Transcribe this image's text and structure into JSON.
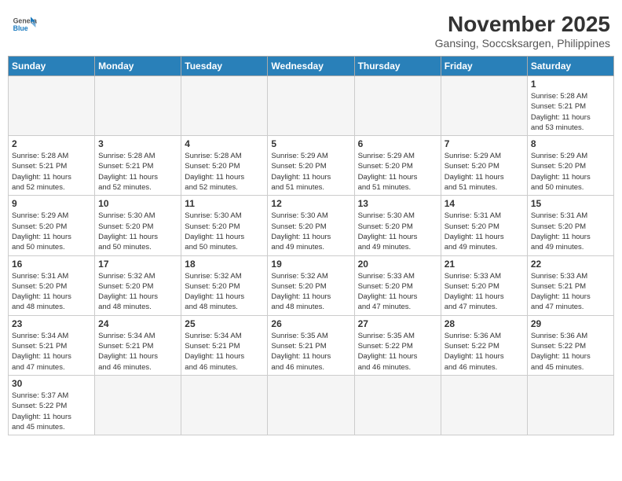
{
  "header": {
    "logo_text_general": "General",
    "logo_text_blue": "Blue",
    "month_title": "November 2025",
    "location": "Gansing, Soccsksargen, Philippines"
  },
  "calendar": {
    "days_of_week": [
      "Sunday",
      "Monday",
      "Tuesday",
      "Wednesday",
      "Thursday",
      "Friday",
      "Saturday"
    ],
    "weeks": [
      [
        {
          "day": "",
          "empty": true,
          "content": ""
        },
        {
          "day": "",
          "empty": true,
          "content": ""
        },
        {
          "day": "",
          "empty": true,
          "content": ""
        },
        {
          "day": "",
          "empty": true,
          "content": ""
        },
        {
          "day": "",
          "empty": true,
          "content": ""
        },
        {
          "day": "",
          "empty": true,
          "content": ""
        },
        {
          "day": "1",
          "empty": false,
          "content": "Sunrise: 5:28 AM\nSunset: 5:21 PM\nDaylight: 11 hours\nand 53 minutes."
        }
      ],
      [
        {
          "day": "2",
          "empty": false,
          "content": "Sunrise: 5:28 AM\nSunset: 5:21 PM\nDaylight: 11 hours\nand 52 minutes."
        },
        {
          "day": "3",
          "empty": false,
          "content": "Sunrise: 5:28 AM\nSunset: 5:21 PM\nDaylight: 11 hours\nand 52 minutes."
        },
        {
          "day": "4",
          "empty": false,
          "content": "Sunrise: 5:28 AM\nSunset: 5:20 PM\nDaylight: 11 hours\nand 52 minutes."
        },
        {
          "day": "5",
          "empty": false,
          "content": "Sunrise: 5:29 AM\nSunset: 5:20 PM\nDaylight: 11 hours\nand 51 minutes."
        },
        {
          "day": "6",
          "empty": false,
          "content": "Sunrise: 5:29 AM\nSunset: 5:20 PM\nDaylight: 11 hours\nand 51 minutes."
        },
        {
          "day": "7",
          "empty": false,
          "content": "Sunrise: 5:29 AM\nSunset: 5:20 PM\nDaylight: 11 hours\nand 51 minutes."
        },
        {
          "day": "8",
          "empty": false,
          "content": "Sunrise: 5:29 AM\nSunset: 5:20 PM\nDaylight: 11 hours\nand 50 minutes."
        }
      ],
      [
        {
          "day": "9",
          "empty": false,
          "content": "Sunrise: 5:29 AM\nSunset: 5:20 PM\nDaylight: 11 hours\nand 50 minutes."
        },
        {
          "day": "10",
          "empty": false,
          "content": "Sunrise: 5:30 AM\nSunset: 5:20 PM\nDaylight: 11 hours\nand 50 minutes."
        },
        {
          "day": "11",
          "empty": false,
          "content": "Sunrise: 5:30 AM\nSunset: 5:20 PM\nDaylight: 11 hours\nand 50 minutes."
        },
        {
          "day": "12",
          "empty": false,
          "content": "Sunrise: 5:30 AM\nSunset: 5:20 PM\nDaylight: 11 hours\nand 49 minutes."
        },
        {
          "day": "13",
          "empty": false,
          "content": "Sunrise: 5:30 AM\nSunset: 5:20 PM\nDaylight: 11 hours\nand 49 minutes."
        },
        {
          "day": "14",
          "empty": false,
          "content": "Sunrise: 5:31 AM\nSunset: 5:20 PM\nDaylight: 11 hours\nand 49 minutes."
        },
        {
          "day": "15",
          "empty": false,
          "content": "Sunrise: 5:31 AM\nSunset: 5:20 PM\nDaylight: 11 hours\nand 49 minutes."
        }
      ],
      [
        {
          "day": "16",
          "empty": false,
          "content": "Sunrise: 5:31 AM\nSunset: 5:20 PM\nDaylight: 11 hours\nand 48 minutes."
        },
        {
          "day": "17",
          "empty": false,
          "content": "Sunrise: 5:32 AM\nSunset: 5:20 PM\nDaylight: 11 hours\nand 48 minutes."
        },
        {
          "day": "18",
          "empty": false,
          "content": "Sunrise: 5:32 AM\nSunset: 5:20 PM\nDaylight: 11 hours\nand 48 minutes."
        },
        {
          "day": "19",
          "empty": false,
          "content": "Sunrise: 5:32 AM\nSunset: 5:20 PM\nDaylight: 11 hours\nand 48 minutes."
        },
        {
          "day": "20",
          "empty": false,
          "content": "Sunrise: 5:33 AM\nSunset: 5:20 PM\nDaylight: 11 hours\nand 47 minutes."
        },
        {
          "day": "21",
          "empty": false,
          "content": "Sunrise: 5:33 AM\nSunset: 5:20 PM\nDaylight: 11 hours\nand 47 minutes."
        },
        {
          "day": "22",
          "empty": false,
          "content": "Sunrise: 5:33 AM\nSunset: 5:21 PM\nDaylight: 11 hours\nand 47 minutes."
        }
      ],
      [
        {
          "day": "23",
          "empty": false,
          "content": "Sunrise: 5:34 AM\nSunset: 5:21 PM\nDaylight: 11 hours\nand 47 minutes."
        },
        {
          "day": "24",
          "empty": false,
          "content": "Sunrise: 5:34 AM\nSunset: 5:21 PM\nDaylight: 11 hours\nand 46 minutes."
        },
        {
          "day": "25",
          "empty": false,
          "content": "Sunrise: 5:34 AM\nSunset: 5:21 PM\nDaylight: 11 hours\nand 46 minutes."
        },
        {
          "day": "26",
          "empty": false,
          "content": "Sunrise: 5:35 AM\nSunset: 5:21 PM\nDaylight: 11 hours\nand 46 minutes."
        },
        {
          "day": "27",
          "empty": false,
          "content": "Sunrise: 5:35 AM\nSunset: 5:22 PM\nDaylight: 11 hours\nand 46 minutes."
        },
        {
          "day": "28",
          "empty": false,
          "content": "Sunrise: 5:36 AM\nSunset: 5:22 PM\nDaylight: 11 hours\nand 46 minutes."
        },
        {
          "day": "29",
          "empty": false,
          "content": "Sunrise: 5:36 AM\nSunset: 5:22 PM\nDaylight: 11 hours\nand 45 minutes."
        }
      ],
      [
        {
          "day": "30",
          "empty": false,
          "last": true,
          "content": "Sunrise: 5:37 AM\nSunset: 5:22 PM\nDaylight: 11 hours\nand 45 minutes."
        },
        {
          "day": "",
          "empty": true,
          "last": true,
          "content": ""
        },
        {
          "day": "",
          "empty": true,
          "last": true,
          "content": ""
        },
        {
          "day": "",
          "empty": true,
          "last": true,
          "content": ""
        },
        {
          "day": "",
          "empty": true,
          "last": true,
          "content": ""
        },
        {
          "day": "",
          "empty": true,
          "last": true,
          "content": ""
        },
        {
          "day": "",
          "empty": true,
          "last": true,
          "content": ""
        }
      ]
    ]
  }
}
